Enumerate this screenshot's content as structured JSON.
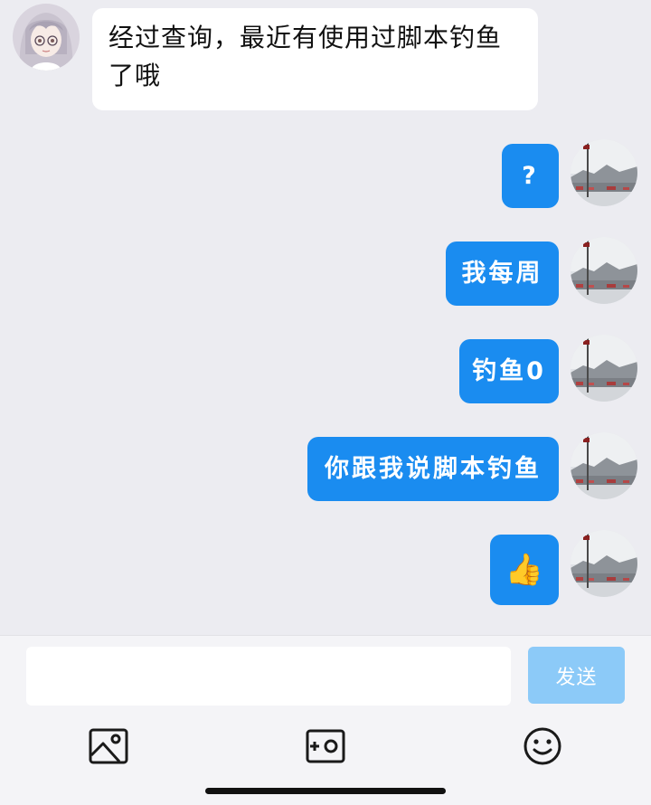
{
  "colors": {
    "background": "#ececf1",
    "incoming_bubble": "#ffffff",
    "outgoing_bubble": "#1a8cf0",
    "send_button": "#8ccaf8"
  },
  "messages": [
    {
      "side": "left",
      "avatar": "anime-girl-avatar",
      "text": "经过查询，最近有使用过脚本钓鱼了哦"
    },
    {
      "side": "right",
      "avatar": "landscape-avatar",
      "text": "?"
    },
    {
      "side": "right",
      "avatar": "landscape-avatar",
      "text": "我每周"
    },
    {
      "side": "right",
      "avatar": "landscape-avatar",
      "text": "钓鱼0"
    },
    {
      "side": "right",
      "avatar": "landscape-avatar",
      "text": "你跟我说脚本钓鱼"
    },
    {
      "side": "right",
      "avatar": "landscape-avatar",
      "text": "👍"
    }
  ],
  "composer": {
    "input_value": "",
    "send_label": "发送",
    "tools": [
      "image-icon",
      "photo-camera-icon",
      "emoji-icon"
    ]
  }
}
